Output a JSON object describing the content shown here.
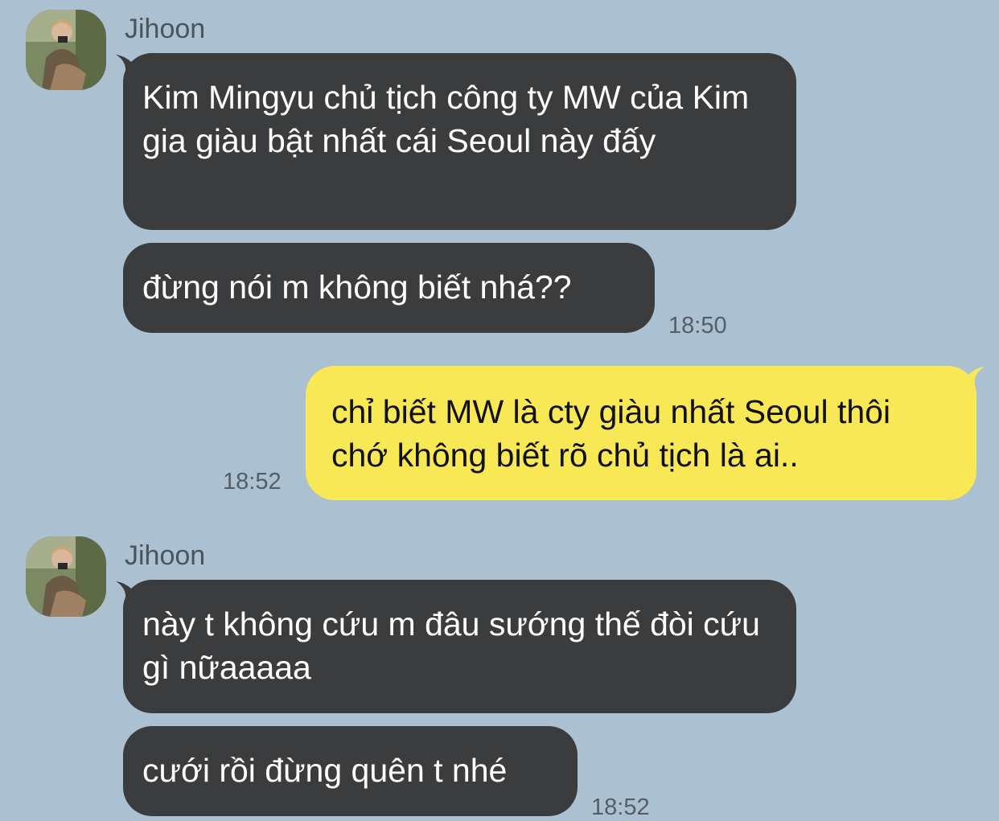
{
  "chat": {
    "groups": [
      {
        "sender": "Jihoon",
        "messages": [
          {
            "text": "Kim Mingyu chủ tịch công ty MW của Kim gia giàu bật nhất cái Seoul này đấy"
          },
          {
            "text": "đừng nói m không biết nhá??",
            "time": "18:50"
          }
        ]
      },
      {
        "sender": "me",
        "messages": [
          {
            "text": "chỉ biết MW là cty giàu nhất Seoul thôi chớ không biết rõ chủ tịch là ai..",
            "time": "18:52"
          }
        ]
      },
      {
        "sender": "Jihoon",
        "messages": [
          {
            "text": "này t không cứu m đâu sướng thế đòi cứu gì nữaaaaa"
          },
          {
            "text": "cưới rồi đừng quên t nhé",
            "time": "18:52"
          }
        ]
      }
    ]
  },
  "colors": {
    "background": "#abc1d1",
    "incoming_bubble": "#3b3c3e",
    "outgoing_bubble": "#f9e855"
  },
  "icons": {
    "avatar": "profile-photo"
  }
}
